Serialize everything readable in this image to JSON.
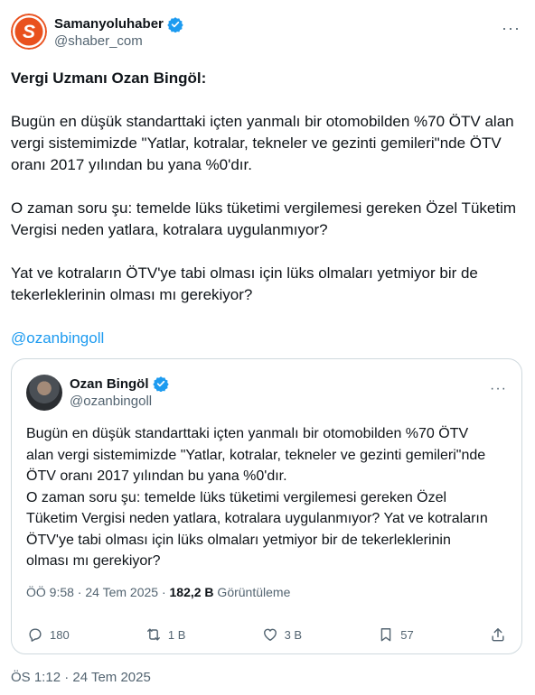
{
  "author": {
    "name": "Samanyoluhaber",
    "handle": "@shaber_com",
    "logo_letter": "S",
    "brand_color": "#e9511e",
    "verified": true
  },
  "tweet": {
    "title": "Vergi Uzmanı Ozan Bingöl:",
    "paragraphs": [
      "Bugün en düşük standarttaki içten yanmalı bir otomobilden %70 ÖTV alan vergi sistemimizde \"Yatlar, kotralar, tekneler ve gezinti gemileri\"nde ÖTV oranı 2017 yılından bu yana %0'dır.",
      "O zaman soru şu: temelde lüks tüketimi vergilemesi gereken Özel Tüketim Vergisi neden yatlara, kotralara uygulanmıyor?",
      "Yat ve kotraların ÖTV'ye tabi olması için lüks olmaları yetmiyor bir de tekerleklerinin olması mı gerekiyor?"
    ],
    "mention": "@ozanbingoll",
    "timestamp": "ÖS 1:12 · 24 Tem 2025"
  },
  "quoted": {
    "name": "Ozan Bingöl",
    "handle": "@ozanbingoll",
    "text": "Bugün en düşük standarttaki içten yanmalı bir otomobilden %70 ÖTV alan vergi sistemimizde \"Yatlar, kotralar, tekneler ve gezinti gemileri\"nde ÖTV oranı 2017 yılından bu yana %0'dır.\nO zaman soru şu: temelde lüks tüketimi vergilemesi gereken Özel Tüketim Vergisi neden yatlara, kotralara uygulanmıyor? Yat ve kotraların ÖTV'ye tabi olması için lüks olmaları yetmiyor bir de tekerleklerinin olması mı gerekiyor?",
    "time": "ÖÖ 9:58 · 24 Tem 2025 · ",
    "views_count": "182,2 B",
    "views_label": " Görüntüleme",
    "actions": {
      "replies": "180",
      "reposts": "1 B",
      "likes": "3 B",
      "bookmarks": "57"
    }
  },
  "colors": {
    "link": "#1d9bf0",
    "muted": "#536471",
    "border": "#cfd9de",
    "verified": "#1d9bf0"
  },
  "icons": [
    "more-icon",
    "verified-badge-icon",
    "reply-icon",
    "repost-icon",
    "like-icon",
    "bookmark-icon",
    "share-icon"
  ]
}
